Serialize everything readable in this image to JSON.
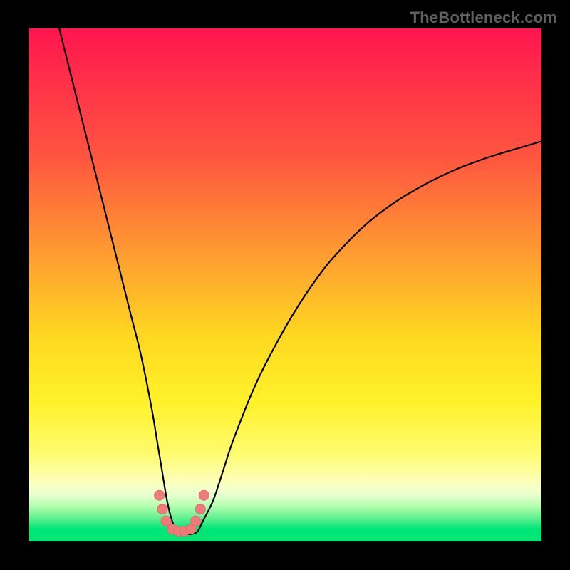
{
  "watermark": "TheBottleneck.com",
  "chart_data": {
    "type": "line",
    "title": "",
    "xlabel": "",
    "ylabel": "",
    "xlim": [
      0,
      100
    ],
    "ylim": [
      0,
      100
    ],
    "grid": false,
    "legend": false,
    "background": "rainbow-vertical",
    "series": [
      {
        "name": "bottleneck-curve",
        "x": [
          6,
          8,
          10,
          12,
          14,
          16,
          18,
          20,
          22,
          24,
          25,
          26,
          27,
          28,
          29,
          30,
          31,
          32,
          33,
          34,
          36,
          38,
          40,
          44,
          48,
          52,
          56,
          60,
          66,
          72,
          78,
          84,
          90,
          96,
          100
        ],
        "y": [
          100,
          92,
          84,
          76,
          68,
          60,
          52,
          44,
          36,
          26,
          20,
          14,
          8,
          4,
          2,
          1.5,
          1.4,
          1.5,
          2,
          4,
          8,
          14,
          20,
          30,
          38,
          45,
          51,
          56,
          62,
          66.5,
          70,
          72.8,
          75,
          76.8,
          78
        ]
      }
    ],
    "markers": {
      "name": "highlight-dots",
      "x": [
        25.5,
        26.1,
        26.8,
        28.0,
        29.2,
        30.4,
        31.6,
        32.6,
        33.5,
        34.2
      ],
      "y": [
        9.0,
        6.3,
        4.0,
        2.4,
        2.0,
        2.0,
        2.4,
        4.0,
        6.3,
        9.0
      ]
    }
  }
}
